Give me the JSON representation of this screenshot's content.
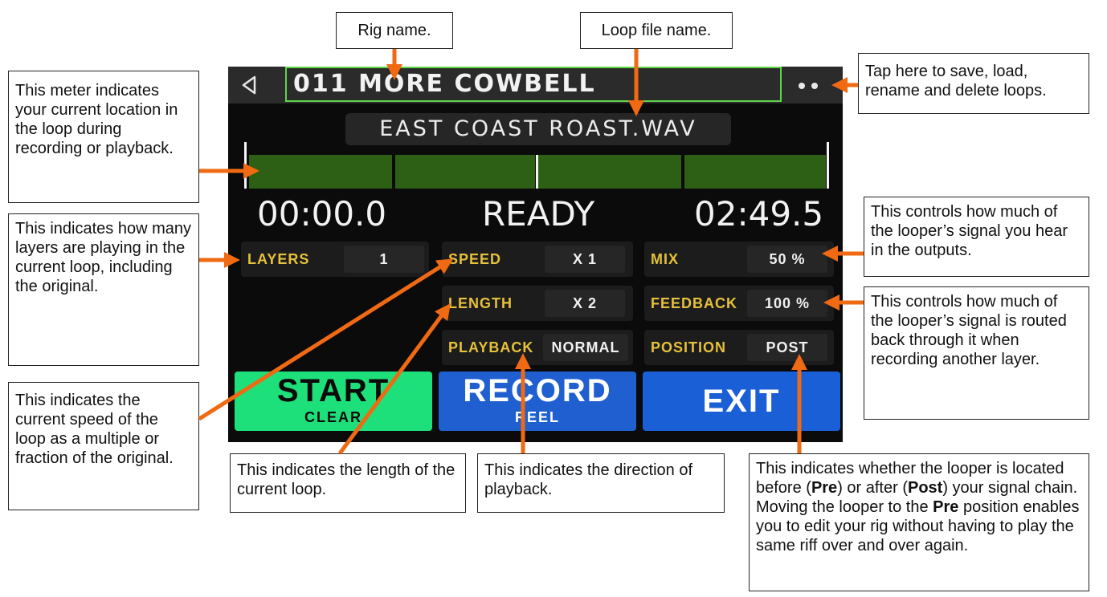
{
  "callouts": {
    "rig_name": "Rig name.",
    "loop_file_name": "Loop file name.",
    "save_load": "Tap here to save, load, rename and delete loops.",
    "meter": "This meter indicates your current location in the loop during recording or playback.",
    "layers": "This indicates how many layers are playing in the current loop, including the original.",
    "speed": "This indicates the current speed of the loop as a multiple or fraction of the original.",
    "length": "This indicates the length of the current loop.",
    "playback": "This indicates the direction of playback.",
    "mix": "This controls how much of the looper’s signal you hear in the outputs.",
    "feedback": "This controls how much of the looper’s signal is routed back through it when recording another layer.",
    "position_1": "This indicates whether the looper is located before (",
    "position_pre": "Pre",
    "position_2": ") or after (",
    "position_post": "Post",
    "position_3": ") your signal chain. Moving the looper to the ",
    "position_pre2": "Pre",
    "position_4": " position enables you to edit your rig without having to play the same riff over and over again."
  },
  "screen": {
    "rig_name": "011 MORE COWBELL",
    "file_name": "EAST COAST ROAST.WAV",
    "time_elapsed": "00:00.0",
    "status": "READY",
    "time_total": "02:49.5",
    "meter_position": 0.0
  },
  "params": {
    "layers": {
      "label": "LAYERS",
      "value": "1"
    },
    "speed": {
      "label": "SPEED",
      "value": "X 1"
    },
    "length": {
      "label": "LENGTH",
      "value": "X 2"
    },
    "playback": {
      "label": "PLAYBACK",
      "value": "NORMAL"
    },
    "mix": {
      "label": "MIX",
      "value": "50 %"
    },
    "feedback": {
      "label": "FEEDBACK",
      "value": "100 %"
    },
    "position": {
      "label": "POSITION",
      "value": "POST"
    }
  },
  "buttons": {
    "start": {
      "label": "START",
      "sub": "CLEAR"
    },
    "record": {
      "label": "RECORD",
      "sub": "REEL"
    },
    "exit": {
      "label": "EXIT"
    }
  },
  "colors": {
    "accent_green": "#5ed64a",
    "meter_green": "#2d5f14",
    "label_yellow": "#e6c13a",
    "start_green": "#1de07a",
    "record_blue": "#1f5fd0",
    "exit_blue": "#1a5fd6",
    "arrow_orange": "#ef6a13"
  },
  "icons": {
    "back": "back-triangle-icon",
    "more": "more-dots-icon"
  }
}
